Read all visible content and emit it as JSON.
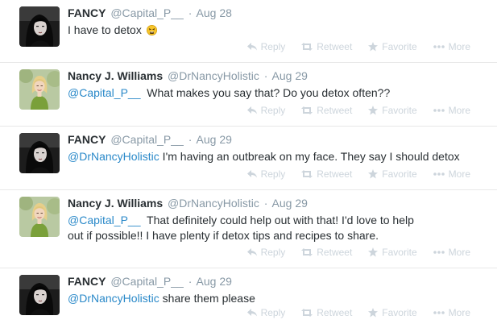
{
  "actions": {
    "reply": "Reply",
    "retweet": "Retweet",
    "favorite": "Favorite",
    "more": "More"
  },
  "tweets": [
    {
      "author": "FANCY",
      "handle": "@Capital_P__",
      "sep": "·",
      "time": "Aug 28",
      "text": "I have to detox",
      "emoji": "tired-face-emoji"
    },
    {
      "author": "Nancy J. Williams",
      "handle": "@DrNancyHolistic",
      "sep": "·",
      "time": "Aug 29",
      "mention": "@Capital_P__",
      "text": "  What makes you say that? Do you detox often??"
    },
    {
      "author": "FANCY",
      "handle": "@Capital_P__",
      "sep": "·",
      "time": "Aug 29",
      "mention": "@DrNancyHolistic",
      "text": " I'm having an outbreak on my face. They say I should detox"
    },
    {
      "author": "Nancy J. Williams",
      "handle": "@DrNancyHolistic",
      "sep": "·",
      "time": "Aug 29",
      "mention": "@Capital_P__",
      "text": "  That definitely could help out with that! I'd love to help out if possible!! I have plenty if detox tips and recipes to share."
    },
    {
      "author": "FANCY",
      "handle": "@Capital_P__",
      "sep": "·",
      "time": "Aug 29",
      "mention": "@DrNancyHolistic",
      "text": " share them please"
    }
  ],
  "colors": {
    "mention": "#2a89c9",
    "meta": "#8899a6",
    "action": "#cdd5dc"
  }
}
